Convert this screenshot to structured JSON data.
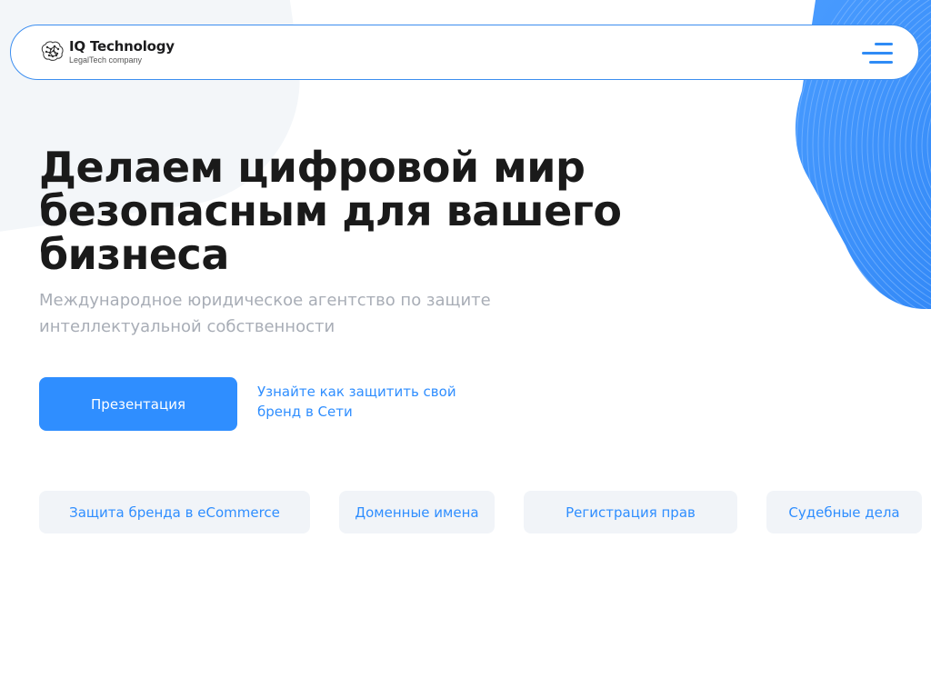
{
  "brand": {
    "name": "IQ Technology",
    "tagline": "LegalTech company",
    "logo_icon": "brain-icon"
  },
  "header": {
    "menu_icon": "hamburger-menu-icon",
    "accent_color": "#3c8ef0"
  },
  "hero": {
    "title": "Делаем цифровой мир безопасным для вашего бизнеса",
    "subtitle": "Международное юридическое агентство по защите интеллектуальной собственности",
    "cta_button_label": "Презентация",
    "cta_link_label": "Узнайте как защитить свой бренд в Сети"
  },
  "services": [
    {
      "label": "Защита бренда в eCommerce"
    },
    {
      "label": "Доменные имена"
    },
    {
      "label": "Регистрация прав"
    },
    {
      "label": "Судебные дела"
    }
  ],
  "colors": {
    "primary": "#2f8eff",
    "title": "#1a1a1a",
    "subtitle": "#a8adb6",
    "chip_bg": "#f1f4f8"
  }
}
